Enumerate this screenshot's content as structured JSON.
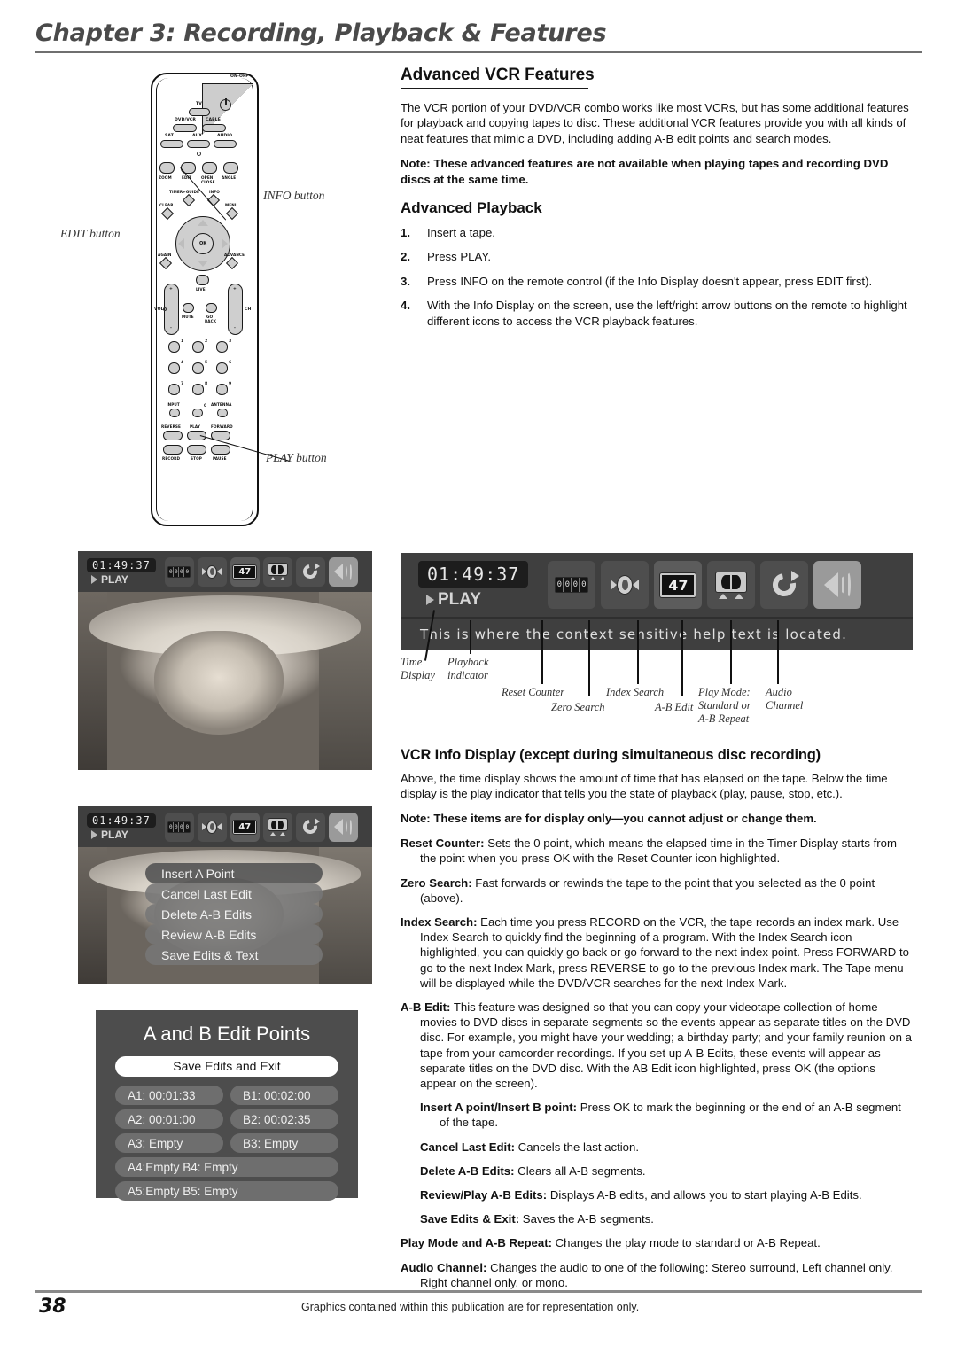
{
  "header": {
    "chapter_title": "Chapter 3: Recording, Playback & Features"
  },
  "main": {
    "section_title": "Advanced VCR Features",
    "intro": "The VCR portion of your DVD/VCR combo works like most VCRs, but has some additional features for playback and copying tapes to disc. These additional VCR features provide you with all kinds of neat features that mimic a DVD, including adding A-B edit points and search modes.",
    "note": "Note: These advanced features are not available when playing tapes and recording DVD discs at the same time.",
    "subsection_title": "Advanced Playback",
    "steps": [
      {
        "num": "1.",
        "text": "Insert a tape."
      },
      {
        "num": "2.",
        "text": "Press PLAY."
      },
      {
        "num": "3.",
        "text": "Press INFO on the remote control (if the Info Display doesn't appear, press EDIT first)."
      },
      {
        "num": "4.",
        "text": "With the Info Display on the screen, use the left/right arrow buttons on the remote to highlight different icons to access the VCR playback features."
      }
    ]
  },
  "info_display_section": {
    "title": "VCR Info Display (except during simultaneous disc recording)",
    "intro": "Above, the time display shows the amount of time that has elapsed on the tape. Below the time display is the play indicator that tells you the state of playback (play, pause, stop, etc.).",
    "note": "Note: These items are for display only—you cannot adjust or change them.",
    "definitions": [
      {
        "term": "Reset Counter:",
        "text": " Sets the 0 point, which means the elapsed time in the Timer Display starts from the point when you press OK with the Reset Counter icon highlighted.",
        "indent": 0
      },
      {
        "term": "Zero Search:",
        "text": " Fast forwards or rewinds the tape to the point that you selected as the 0 point (above).",
        "indent": 0
      },
      {
        "term": "Index Search:",
        "text": " Each time you press RECORD on the VCR, the tape records an index mark. Use Index Search to quickly find the beginning of a program. With the Index Search icon highlighted, you can quickly go back or go forward to the next index point. Press FORWARD to go to the next Index Mark, press REVERSE to go to the previous Index mark. The Tape menu will be displayed while the DVD/VCR searches for the next Index Mark.",
        "indent": 0
      },
      {
        "term": "A-B Edit:",
        "text": " This feature was designed so that you can copy your videotape collection of home movies to DVD discs in separate segments so the events appear as separate titles on the DVD disc. For example, you might have your wedding; a birthday party; and your family reunion on a tape from your camcorder recordings. If you set up A-B Edits, these events will appear as separate titles on the DVD disc. With the AB Edit icon highlighted, press OK (the options appear on the screen).",
        "indent": 0
      },
      {
        "term": "Insert A point/Insert B point:",
        "text": " Press OK to mark the beginning or the end of an A-B segment of the tape.",
        "indent": 1
      },
      {
        "term": "Cancel Last Edit:",
        "text": " Cancels the last action.",
        "indent": 1
      },
      {
        "term": "Delete A-B Edits:",
        "text": " Clears all A-B segments.",
        "indent": 1
      },
      {
        "term": "Review/Play A-B Edits:",
        "text": " Displays A-B edits, and allows you to start playing A-B Edits.",
        "indent": 1
      },
      {
        "term": "Save Edits & Exit:",
        "text": " Saves the A-B segments.",
        "indent": 1
      },
      {
        "term": "Play Mode and A-B Repeat:",
        "text": " Changes the play mode to standard or A-B Repeat.",
        "indent": 0
      },
      {
        "term": "Audio Channel:",
        "text": " Changes the audio to one of the following: Stereo surround, Left channel only, Right channel only, or mono.",
        "indent": 0
      }
    ]
  },
  "remote": {
    "callouts": [
      {
        "label": "EDIT button"
      },
      {
        "label": "INFO button"
      },
      {
        "label": "PLAY button"
      }
    ],
    "buttons": {
      "on_off": "ON-OFF",
      "tv": "TV",
      "dvd_vcr": "DVD/VCR",
      "cable": "CABLE",
      "sat": "SAT",
      "aux": "AUX",
      "audio": "AUDIO",
      "zoom": "ZOOM",
      "edit": "EDIT",
      "open": "OPEN",
      "close": "CLOSE",
      "angle": "ANGLE",
      "timer_guide": "TIMER+GUIDE",
      "info": "INFO",
      "clear": "CLEAR",
      "menu": "MENU",
      "ok": "OK",
      "again": "AGAIN",
      "advance": "ADVANCE",
      "live": "LIVE",
      "vol": "VOL",
      "ch": "CH",
      "mute": "MUTE",
      "go": "GO",
      "back": "BACK",
      "input": "INPUT",
      "antenna": "ANTENNA",
      "reverse": "REVERSE",
      "play": "PLAY",
      "forward": "FORWARD",
      "record": "RECORD",
      "stop": "STOP",
      "pause": "PAUSE",
      "plus": "+",
      "minus": "-",
      "numbers": [
        "1",
        "2",
        "3",
        "4",
        "5",
        "6",
        "7",
        "8",
        "9",
        "0"
      ]
    }
  },
  "osd": {
    "time": "01:49:37",
    "play_label": "PLAY",
    "index_number": "47",
    "counter_digits": [
      "0",
      "0",
      "0",
      "0"
    ],
    "help_text": "This is where the context sensitive help text is located.",
    "icon_names": [
      "reset-counter-icon",
      "zero-search-icon",
      "index-search-icon",
      "ab-edit-icon",
      "play-mode-icon",
      "audio-channel-icon"
    ],
    "callouts": [
      {
        "label": "Time\nDisplay"
      },
      {
        "label": "Playback\nindicator"
      },
      {
        "label": "Reset Counter"
      },
      {
        "label": "Zero Search"
      },
      {
        "label": "Index Search"
      },
      {
        "label": "A-B Edit"
      },
      {
        "label": "Play Mode:\nStandard or\nA-B Repeat"
      },
      {
        "label": "Audio\nChannel"
      }
    ]
  },
  "ab_menu": {
    "items": [
      "Insert A Point",
      "Cancel Last Edit",
      "Delete A-B Edits",
      "Review A-B Edits",
      "Save Edits & Text"
    ]
  },
  "ab_points_screen": {
    "title": "A and B Edit Points",
    "save_button": "Save Edits and Exit",
    "rows": [
      {
        "a": "A1: 00:01:33",
        "b": "B1: 00:02:00",
        "wide": false
      },
      {
        "a": "A2: 00:01:00",
        "b": "B2: 00:02:35",
        "wide": false
      },
      {
        "a": "A3: Empty",
        "b": "B3: Empty",
        "wide": false
      },
      {
        "a": "A4:Empty B4: Empty",
        "b": "",
        "wide": true
      },
      {
        "a": "A5:Empty B5: Empty",
        "b": "",
        "wide": true
      }
    ]
  },
  "footer": {
    "page_number": "38",
    "note": "Graphics contained within this publication are for representation only."
  },
  "colors": {
    "rule": "#6f6f6f",
    "osd_bar": "#3f3f3f",
    "panel": "#4d4d4d"
  }
}
